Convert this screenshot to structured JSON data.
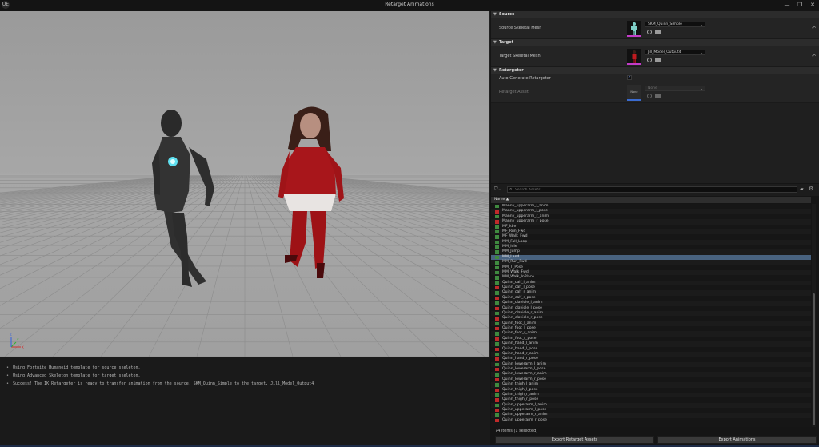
{
  "window": {
    "title": "Retarget Animations",
    "logo": "UE",
    "minimize_glyph": "—",
    "maximize_glyph": "❐",
    "close_glyph": "✕"
  },
  "details": {
    "source": {
      "header": "Source",
      "label": "Source Skeletal Mesh",
      "value": "SKM_Quinn_Simple"
    },
    "target": {
      "header": "Target",
      "label": "Target Skeletal Mesh",
      "value": "Jill_Model_Output4"
    },
    "retargeter": {
      "header": "Retargeter",
      "auto_label": "Auto Generate Retargeter",
      "auto_checked": true,
      "asset_label": "Retarget Asset",
      "asset_value": "None",
      "thumb_text": "None"
    }
  },
  "asset_browser": {
    "search_placeholder": "Search Assets",
    "column_header": "Name ▲",
    "items": [
      {
        "name": "Manny_upperarm_l_anim",
        "color": "#3f8a3f"
      },
      {
        "name": "Manny_upperarm_l_pose",
        "color": "#c02a2a"
      },
      {
        "name": "Manny_upperarm_r_anim",
        "color": "#3f8a3f"
      },
      {
        "name": "Manny_upperarm_r_pose",
        "color": "#c02a2a"
      },
      {
        "name": "MF_Idle",
        "color": "#3f8a3f"
      },
      {
        "name": "MF_Run_Fwd",
        "color": "#3f8a3f"
      },
      {
        "name": "MF_Walk_Fwd",
        "color": "#3f8a3f"
      },
      {
        "name": "MM_Fall_Loop",
        "color": "#3f8a3f"
      },
      {
        "name": "MM_Idle",
        "color": "#3f8a3f"
      },
      {
        "name": "MM_Jump",
        "color": "#3f8a3f"
      },
      {
        "name": "MM_Land",
        "color": "#3f8a3f",
        "selected": true
      },
      {
        "name": "MM_Run_Fwd",
        "color": "#3f8a3f"
      },
      {
        "name": "MM_T_Pose",
        "color": "#3f8a3f"
      },
      {
        "name": "MM_Walk_Fwd",
        "color": "#3f8a3f"
      },
      {
        "name": "MM_Walk_InPlace",
        "color": "#3f8a3f"
      },
      {
        "name": "Quinn_calf_l_anim",
        "color": "#3f8a3f"
      },
      {
        "name": "Quinn_calf_l_pose",
        "color": "#c02a2a"
      },
      {
        "name": "Quinn_calf_r_anim",
        "color": "#3f8a3f"
      },
      {
        "name": "Quinn_calf_r_pose",
        "color": "#c02a2a"
      },
      {
        "name": "Quinn_clavicle_l_anim",
        "color": "#3f8a3f"
      },
      {
        "name": "Quinn_clavicle_l_pose",
        "color": "#c02a2a"
      },
      {
        "name": "Quinn_clavicle_r_anim",
        "color": "#3f8a3f"
      },
      {
        "name": "Quinn_clavicle_r_pose",
        "color": "#c02a2a"
      },
      {
        "name": "Quinn_foot_l_anim",
        "color": "#3f8a3f"
      },
      {
        "name": "Quinn_foot_l_pose",
        "color": "#c02a2a"
      },
      {
        "name": "Quinn_foot_r_anim",
        "color": "#3f8a3f"
      },
      {
        "name": "Quinn_foot_r_pose",
        "color": "#c02a2a"
      },
      {
        "name": "Quinn_hand_l_anim",
        "color": "#3f8a3f"
      },
      {
        "name": "Quinn_hand_l_pose",
        "color": "#c02a2a"
      },
      {
        "name": "Quinn_hand_r_anim",
        "color": "#3f8a3f"
      },
      {
        "name": "Quinn_hand_r_pose",
        "color": "#c02a2a"
      },
      {
        "name": "Quinn_lowerarm_l_anim",
        "color": "#3f8a3f"
      },
      {
        "name": "Quinn_lowerarm_l_pose",
        "color": "#c02a2a"
      },
      {
        "name": "Quinn_lowerarm_r_anim",
        "color": "#3f8a3f"
      },
      {
        "name": "Quinn_lowerarm_r_pose",
        "color": "#c02a2a"
      },
      {
        "name": "Quinn_thigh_l_anim",
        "color": "#3f8a3f"
      },
      {
        "name": "Quinn_thigh_l_pose",
        "color": "#c02a2a"
      },
      {
        "name": "Quinn_thigh_r_anim",
        "color": "#3f8a3f"
      },
      {
        "name": "Quinn_thigh_r_pose",
        "color": "#c02a2a"
      },
      {
        "name": "Quinn_upperarm_l_anim",
        "color": "#3f8a3f"
      },
      {
        "name": "Quinn_upperarm_l_pose",
        "color": "#c02a2a"
      },
      {
        "name": "Quinn_upperarm_r_anim",
        "color": "#3f8a3f"
      },
      {
        "name": "Quinn_upperarm_r_pose",
        "color": "#c02a2a"
      }
    ],
    "item_count": "74 items (1 selected)",
    "export_assets_label": "Export Retarget Assets",
    "export_animations_label": "Export Animations"
  },
  "output_log": [
    "Using Fortnite Humanoid template for source skeleton.",
    "Using Advanced Skeleton template for target skeleton.",
    "Success! The IK Retargeter is ready to transfer animation from the source, SKM_Quinn_Simple to the target, Jill_Model_Output4"
  ],
  "viewport": {
    "axis_labels": {
      "x": "X",
      "y": "Y",
      "z": "Z"
    }
  },
  "colors": {
    "anim_green": "#3f8a3f",
    "pose_red": "#c02a2a",
    "selection": "#48627f",
    "accent_blue": "#3a6bd0"
  }
}
